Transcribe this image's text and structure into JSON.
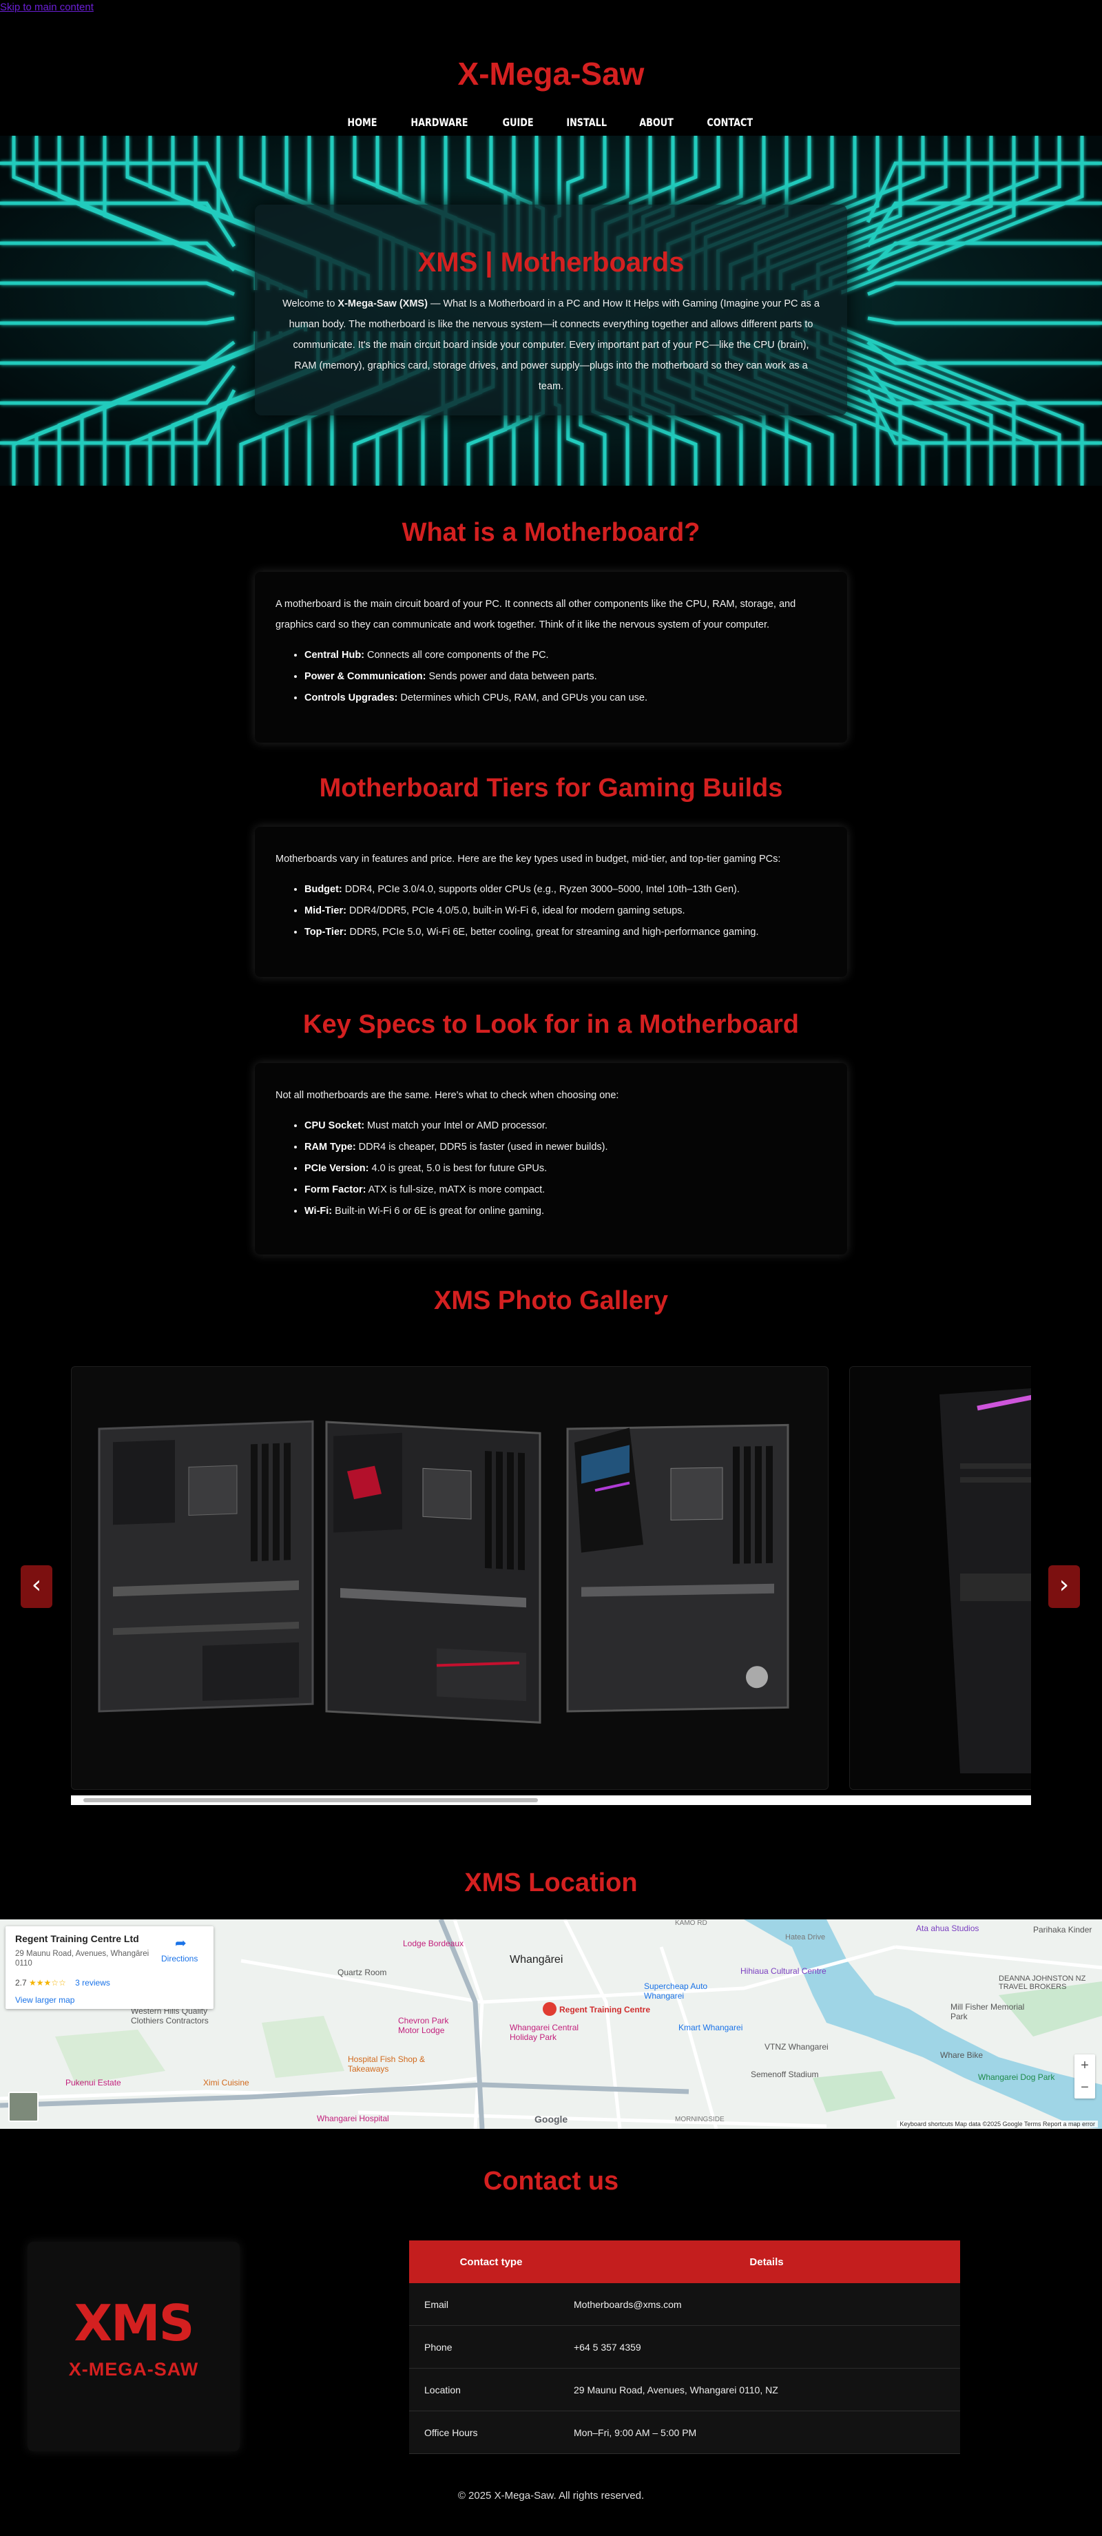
{
  "skip_link": "Skip to main content",
  "site_title": "X-Mega-Saw",
  "nav": [
    "HOME",
    "HARDWARE",
    "GUIDE",
    "INSTALL",
    "ABOUT",
    "CONTACT"
  ],
  "hero": {
    "title": "XMS | Motherboards",
    "intro_lead": "Welcome to ",
    "intro_brand": "X-Mega-Saw (XMS)",
    "intro_rest": " — What Is a Motherboard in a PC and How It Helps with Gaming (Imagine your PC as a human body. The motherboard is like the nervous system—it connects everything together and allows different parts to communicate. It's the main circuit board inside your computer. Every important part of your PC—like the CPU (brain), RAM (memory), graphics card, storage drives, and power supply—plugs into the motherboard so they can work as a team."
  },
  "section1": {
    "title": "What is a Motherboard?",
    "text": "A motherboard is the main circuit board of your PC. It connects all other components like the CPU, RAM, storage, and graphics card so they can communicate and work together. Think of it like the nervous system of your computer.",
    "items": [
      {
        "term": "Central Hub:",
        "desc": " Connects all core components of the PC."
      },
      {
        "term": "Power & Communication:",
        "desc": " Sends power and data between parts."
      },
      {
        "term": "Controls Upgrades:",
        "desc": " Determines which CPUs, RAM, and GPUs you can use."
      }
    ]
  },
  "section2": {
    "title": "Motherboard Tiers for Gaming Builds",
    "text": "Motherboards vary in features and price. Here are the key types used in budget, mid-tier, and top-tier gaming PCs:",
    "items": [
      {
        "term": "Budget:",
        "desc": " DDR4, PCIe 3.0/4.0, supports older CPUs (e.g., Ryzen 3000–5000, Intel 10th–13th Gen)."
      },
      {
        "term": "Mid-Tier:",
        "desc": " DDR4/DDR5, PCIe 4.0/5.0, built-in Wi-Fi 6, ideal for modern gaming setups."
      },
      {
        "term": "Top-Tier:",
        "desc": " DDR5, PCIe 5.0, Wi-Fi 6E, better cooling, great for streaming and high-performance gaming."
      }
    ]
  },
  "section3": {
    "title": "Key Specs to Look for in a Motherboard",
    "text": "Not all motherboards are the same. Here's what to check when choosing one:",
    "items": [
      {
        "term": "CPU Socket:",
        "desc": " Must match your Intel or AMD processor."
      },
      {
        "term": "RAM Type:",
        "desc": " DDR4 is cheaper, DDR5 is faster (used in newer builds)."
      },
      {
        "term": "PCIe Version:",
        "desc": " 4.0 is great, 5.0 is best for future GPUs."
      },
      {
        "term": "Form Factor:",
        "desc": " ATX is full-size, mATX is more compact."
      },
      {
        "term": "Wi-Fi:",
        "desc": " Built-in Wi-Fi 6 or 6E is great for online gaming."
      }
    ]
  },
  "gallery": {
    "title": "XMS Photo Gallery",
    "prev": "‹",
    "next": "›"
  },
  "location": {
    "title": "XMS Location",
    "place_name": "Regent Training Centre Ltd",
    "address": "29 Maunu Road, Avenues, Whangārei 0110",
    "rating": "2.7",
    "stars": "★★★☆☆",
    "reviews": "3 reviews",
    "larger_map": "View larger map",
    "directions": "Directions",
    "labels": {
      "marker": "Regent Training Centre",
      "city": "Whangārei",
      "lodge": "Lodge Bordeaux",
      "quartz": "Quartz Room",
      "western": "Western Hills Quality Clothiers Contractors",
      "chevron": "Chevron Park Motor Lodge",
      "hfish": "Hospital Fish Shop & Takeaways",
      "hospital": "Whangarei Hospital",
      "pukenui": "Pukenui Estate",
      "ximi": "Ximi Cuisine",
      "holiday": "Whangarei Central Holiday Park",
      "supercheap": "Supercheap Auto Whangarei",
      "kmart": "Kmart Whangarei",
      "hihiaua": "Hihiaua Cultural Centre",
      "vtnz": "VTNZ Whangarei",
      "semenoff": "Semenoff Stadium",
      "whare": "Whare Bike",
      "dog": "Whangarei Dog Park",
      "millfish": "Mill Fisher Memorial Park",
      "deanna": "DEANNA JOHNSTON NZ TRAVEL BROKERS",
      "atahua": "Ata ahua Studios",
      "parihaka": "Parihaka Kinder",
      "hatea": "Hatea Drive",
      "morningside": "MORNINGSIDE",
      "kamo": "KAMO RD",
      "google": "Google"
    },
    "attribution": "Keyboard shortcuts   Map data ©2025 Google   Terms   Report a map error"
  },
  "contact": {
    "title": "Contact us",
    "logo_mark": "XMS",
    "logo_text": "X-MEGA-SAW",
    "headers": [
      "Contact type",
      "Details"
    ],
    "rows": [
      [
        "Email",
        "Motherboards@xms.com"
      ],
      [
        "Phone",
        "+64 5 357 4359"
      ],
      [
        "Location",
        "29 Maunu Road, Avenues, Whangarei 0110, NZ"
      ],
      [
        "Office Hours",
        "Mon–Fri, 9:00 AM – 5:00 PM"
      ]
    ]
  },
  "footer": "© 2025 X-Mega-Saw. All rights reserved.",
  "colors": {
    "accent": "#d42020",
    "background": "#000000",
    "circuit": "#1fd6c8"
  }
}
